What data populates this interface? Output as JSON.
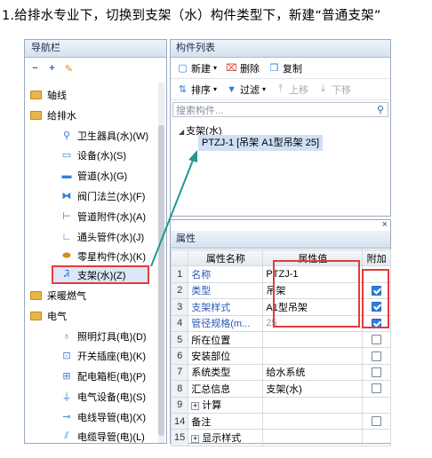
{
  "instruction": "1.给排水专业下，切换到支架（水）构件类型下，新建“普通支架”",
  "nav": {
    "title": "导航栏",
    "tools": [
      "collapse-icon",
      "expand-icon",
      "edit-icon"
    ],
    "items": [
      {
        "label": "轴线",
        "icon": "folder-icon",
        "level": 0
      },
      {
        "label": "给排水",
        "icon": "folder-icon",
        "level": 0
      },
      {
        "label": "卫生器具(水)(W)",
        "icon": "sanitary-icon",
        "level": 1
      },
      {
        "label": "设备(水)(S)",
        "icon": "equipment-icon",
        "level": 1
      },
      {
        "label": "管道(水)(G)",
        "icon": "pipe-icon",
        "level": 1
      },
      {
        "label": "阀门法兰(水)(F)",
        "icon": "valve-icon",
        "level": 1
      },
      {
        "label": "管道附件(水)(A)",
        "icon": "pipe-accessory-icon",
        "level": 1
      },
      {
        "label": "通头管件(水)(J)",
        "icon": "fitting-icon",
        "level": 1
      },
      {
        "label": "零星构件(水)(K)",
        "icon": "misc-part-icon",
        "level": 1
      },
      {
        "label": "支架(水)(Z)",
        "icon": "support-icon",
        "level": 1
      },
      {
        "label": "采暖燃气",
        "icon": "folder-icon",
        "level": 0
      },
      {
        "label": "电气",
        "icon": "folder-icon",
        "level": 0
      },
      {
        "label": "照明灯具(电)(D)",
        "icon": "lamp-icon",
        "level": 1
      },
      {
        "label": "开关插座(电)(K)",
        "icon": "switch-icon",
        "level": 1
      },
      {
        "label": "配电箱柜(电)(P)",
        "icon": "distribution-box-icon",
        "level": 1
      },
      {
        "label": "电气设备(电)(S)",
        "icon": "electric-equipment-icon",
        "level": 1
      },
      {
        "label": "电线导管(电)(X)",
        "icon": "wire-conduit-icon",
        "level": 1
      },
      {
        "label": "电缆导管(电)(L)",
        "icon": "cable-conduit-icon",
        "level": 1
      }
    ]
  },
  "component_list": {
    "title": "构件列表",
    "toolbar_row1": [
      {
        "label": "新建",
        "icon": "new-icon",
        "dropdown": true
      },
      {
        "label": "删除",
        "icon": "delete-icon"
      },
      {
        "label": "复制",
        "icon": "copy-icon"
      }
    ],
    "toolbar_row2": [
      {
        "label": "排序",
        "icon": "sort-icon",
        "dropdown": true
      },
      {
        "label": "过滤",
        "icon": "filter-icon",
        "dropdown": true
      },
      {
        "label": "上移",
        "icon": "move-up-icon",
        "disabled": true
      },
      {
        "label": "下移",
        "icon": "move-down-icon",
        "disabled": true
      }
    ],
    "search_placeholder": "搜索构件...",
    "tree_parent": "支架(水)",
    "tree_child": "PTZJ-1 [吊架 A1型吊架 25]"
  },
  "properties": {
    "title": "属性",
    "close": "×",
    "headers": [
      "",
      "属性名称",
      "属性值",
      "附加"
    ],
    "rows": [
      {
        "num": "1",
        "name": "名称",
        "value": "PTZJ-1",
        "blue": true,
        "check": null
      },
      {
        "num": "2",
        "name": "类型",
        "value": "吊架",
        "blue": true,
        "check": true
      },
      {
        "num": "3",
        "name": "支架样式",
        "value": "A1型吊架",
        "blue": true,
        "check": true
      },
      {
        "num": "4",
        "name": "管径规格(m...",
        "value": "25",
        "blue": true,
        "check": true,
        "gray": true
      },
      {
        "num": "5",
        "name": "所在位置",
        "value": "",
        "check": false
      },
      {
        "num": "6",
        "name": "安装部位",
        "value": "",
        "check": false
      },
      {
        "num": "7",
        "name": "系统类型",
        "value": "给水系统",
        "check": false
      },
      {
        "num": "8",
        "name": "汇总信息",
        "value": "支架(水)",
        "check": false
      },
      {
        "num": "9",
        "name": "计算",
        "value": "",
        "expand": true
      },
      {
        "num": "14",
        "name": "备注",
        "value": "",
        "check": false
      },
      {
        "num": "15",
        "name": "显示样式",
        "value": "",
        "expand": true
      }
    ]
  },
  "colors": {
    "highlight_red": "#e23b3b",
    "arrow_teal": "#1f9a8c",
    "selection_blue": "#cfe0f5",
    "link_blue": "#2a58b8"
  }
}
